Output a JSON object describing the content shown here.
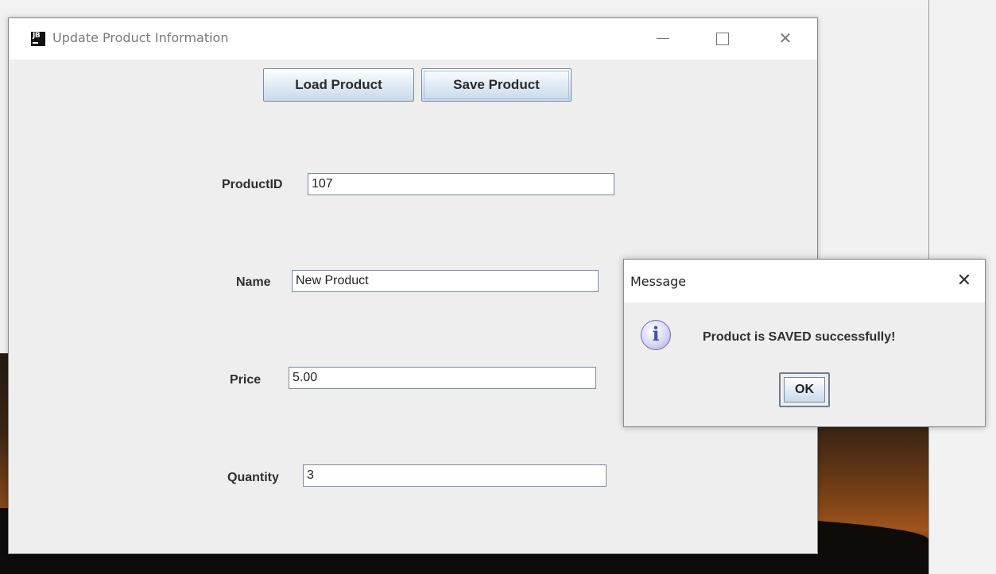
{
  "main_window": {
    "title": "Update Product Information",
    "icon_label": "JB",
    "controls": {
      "minimize": "minimize-icon",
      "maximize": "maximize-icon",
      "close": "✕"
    }
  },
  "toolbar": {
    "load_label": "Load Product",
    "save_label": "Save Product"
  },
  "form": {
    "product_id": {
      "label": "ProductID",
      "value": "107"
    },
    "name": {
      "label": "Name",
      "value": "New Product"
    },
    "price": {
      "label": "Price",
      "value": "5.00"
    },
    "quantity": {
      "label": "Quantity",
      "value": "3"
    }
  },
  "dialog": {
    "title": "Message",
    "close_glyph": "✕",
    "icon_glyph": "i",
    "message": "Product is SAVED successfully!",
    "ok_label": "OK"
  },
  "colors": {
    "window_bg": "#eeeeee",
    "button_border": "#7a8aa0",
    "info_icon": "#4a50a8"
  }
}
